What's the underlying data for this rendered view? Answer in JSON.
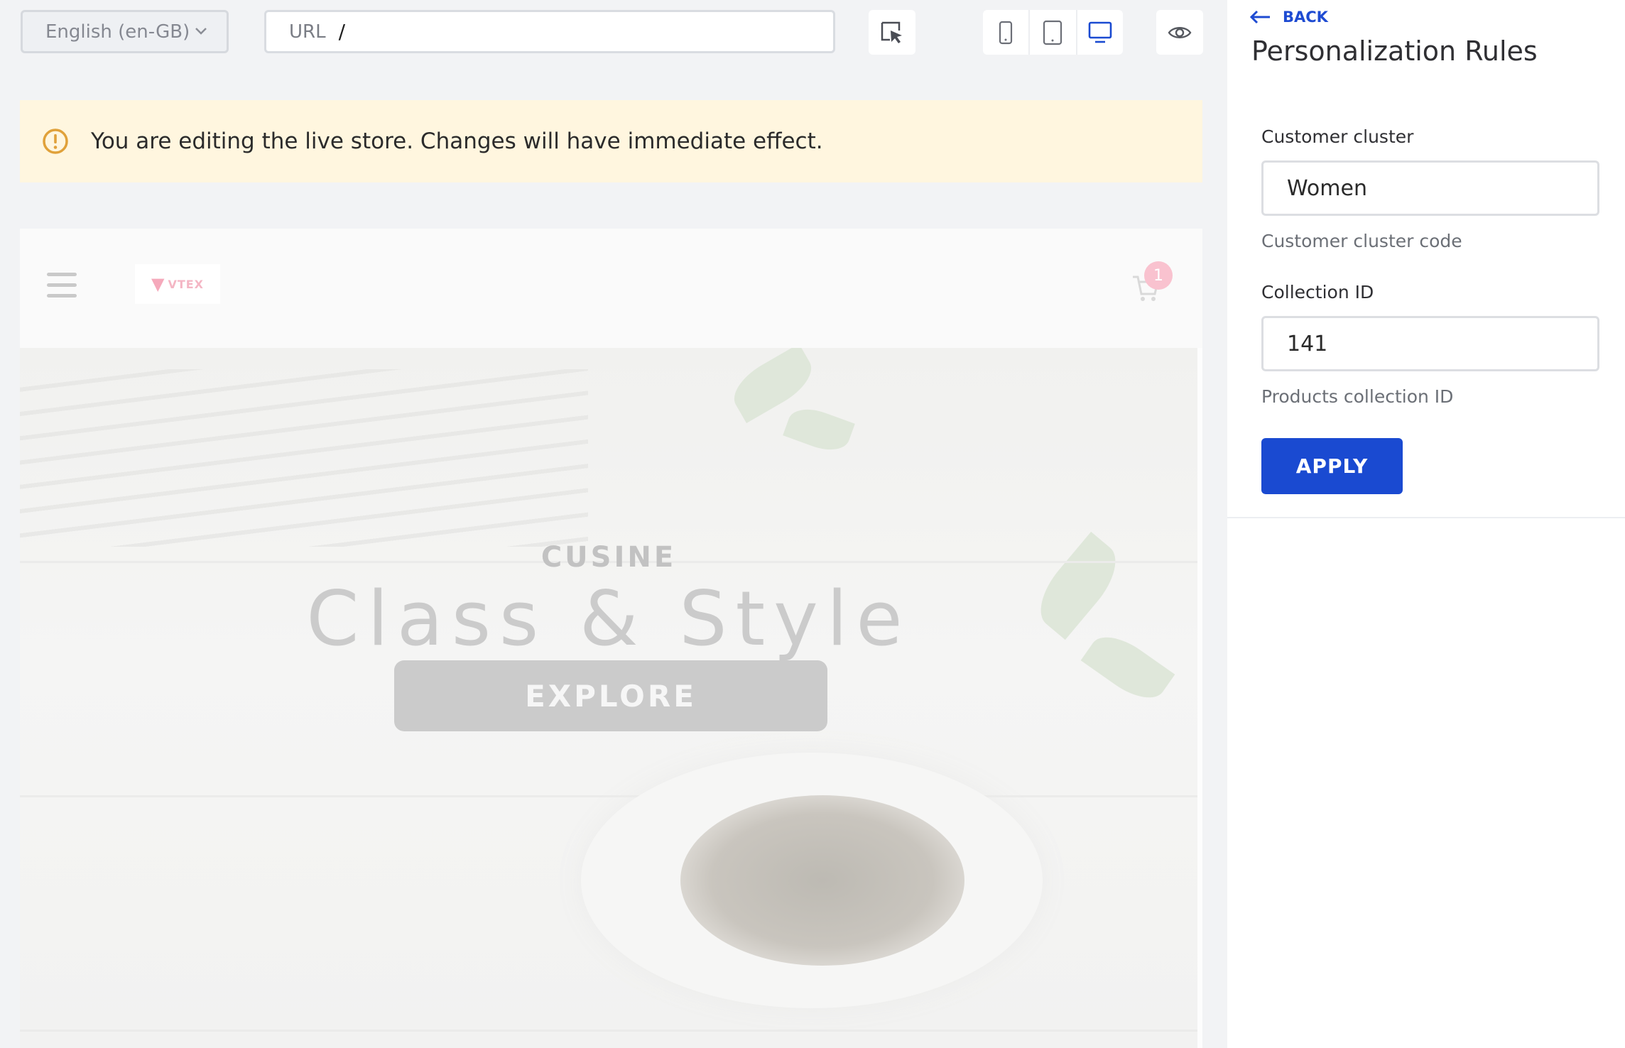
{
  "toolbar": {
    "locale": "English (en-GB)",
    "url_label": "URL",
    "url_value": "/",
    "active_device": "desktop"
  },
  "warning": {
    "message": "You are editing the live store. Changes will have immediate effect."
  },
  "store": {
    "logo_text": "VTEX",
    "cart_count": "1",
    "hero_kicker": "CUSINE",
    "hero_title": "Class & Style",
    "hero_cta": "EXPLORE"
  },
  "sidebar": {
    "back_label": "BACK",
    "title": "Personalization Rules",
    "fields": [
      {
        "label": "Customer cluster",
        "value": "Women",
        "helper": "Customer cluster code"
      },
      {
        "label": "Collection ID",
        "value": "141",
        "helper": "Products collection ID"
      }
    ],
    "apply_label": "APPLY"
  },
  "colors": {
    "primary": "#1a4ad1",
    "warning_bg": "#fff6df",
    "warning_icon": "#e0a13a"
  }
}
